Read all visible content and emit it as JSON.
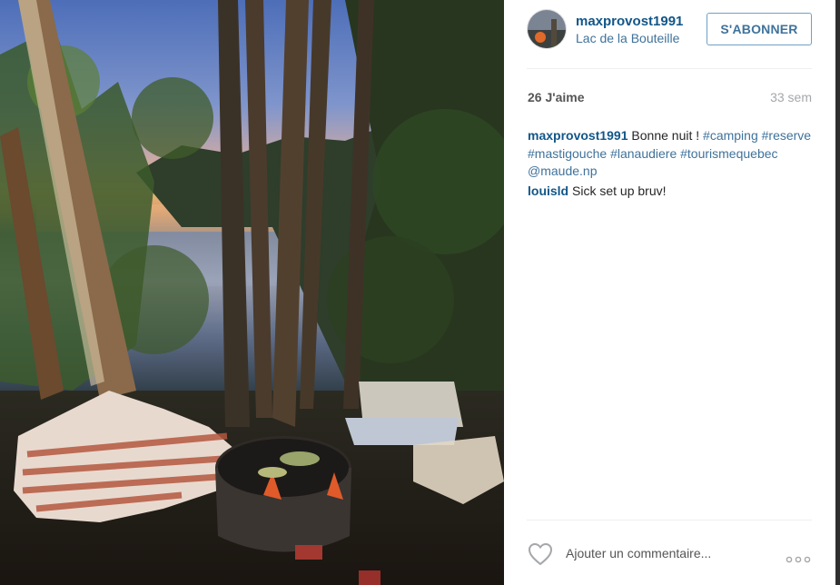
{
  "post": {
    "username": "maxprovost1991",
    "location": "Lac de la Bouteille",
    "follow_label": "S'ABONNER",
    "likes": "26 J'aime",
    "time_ago": "33 sem"
  },
  "comments": [
    {
      "user": "maxprovost1991",
      "text": "Bonne nuit !",
      "tags": [
        "#camping",
        "#reserve",
        "#mastigouche",
        "#lanaudiere",
        "#tourismequebec",
        "@maude.np"
      ]
    },
    {
      "user": "louisld",
      "text": "Sick set up bruv!"
    }
  ],
  "footer": {
    "comment_placeholder": "Ajouter un commentaire...",
    "like_icon": "heart-icon",
    "more_icon": "more-options-icon"
  },
  "colors": {
    "username": "#125688",
    "link": "#3f729b",
    "follow_border": "#70a0c6"
  }
}
